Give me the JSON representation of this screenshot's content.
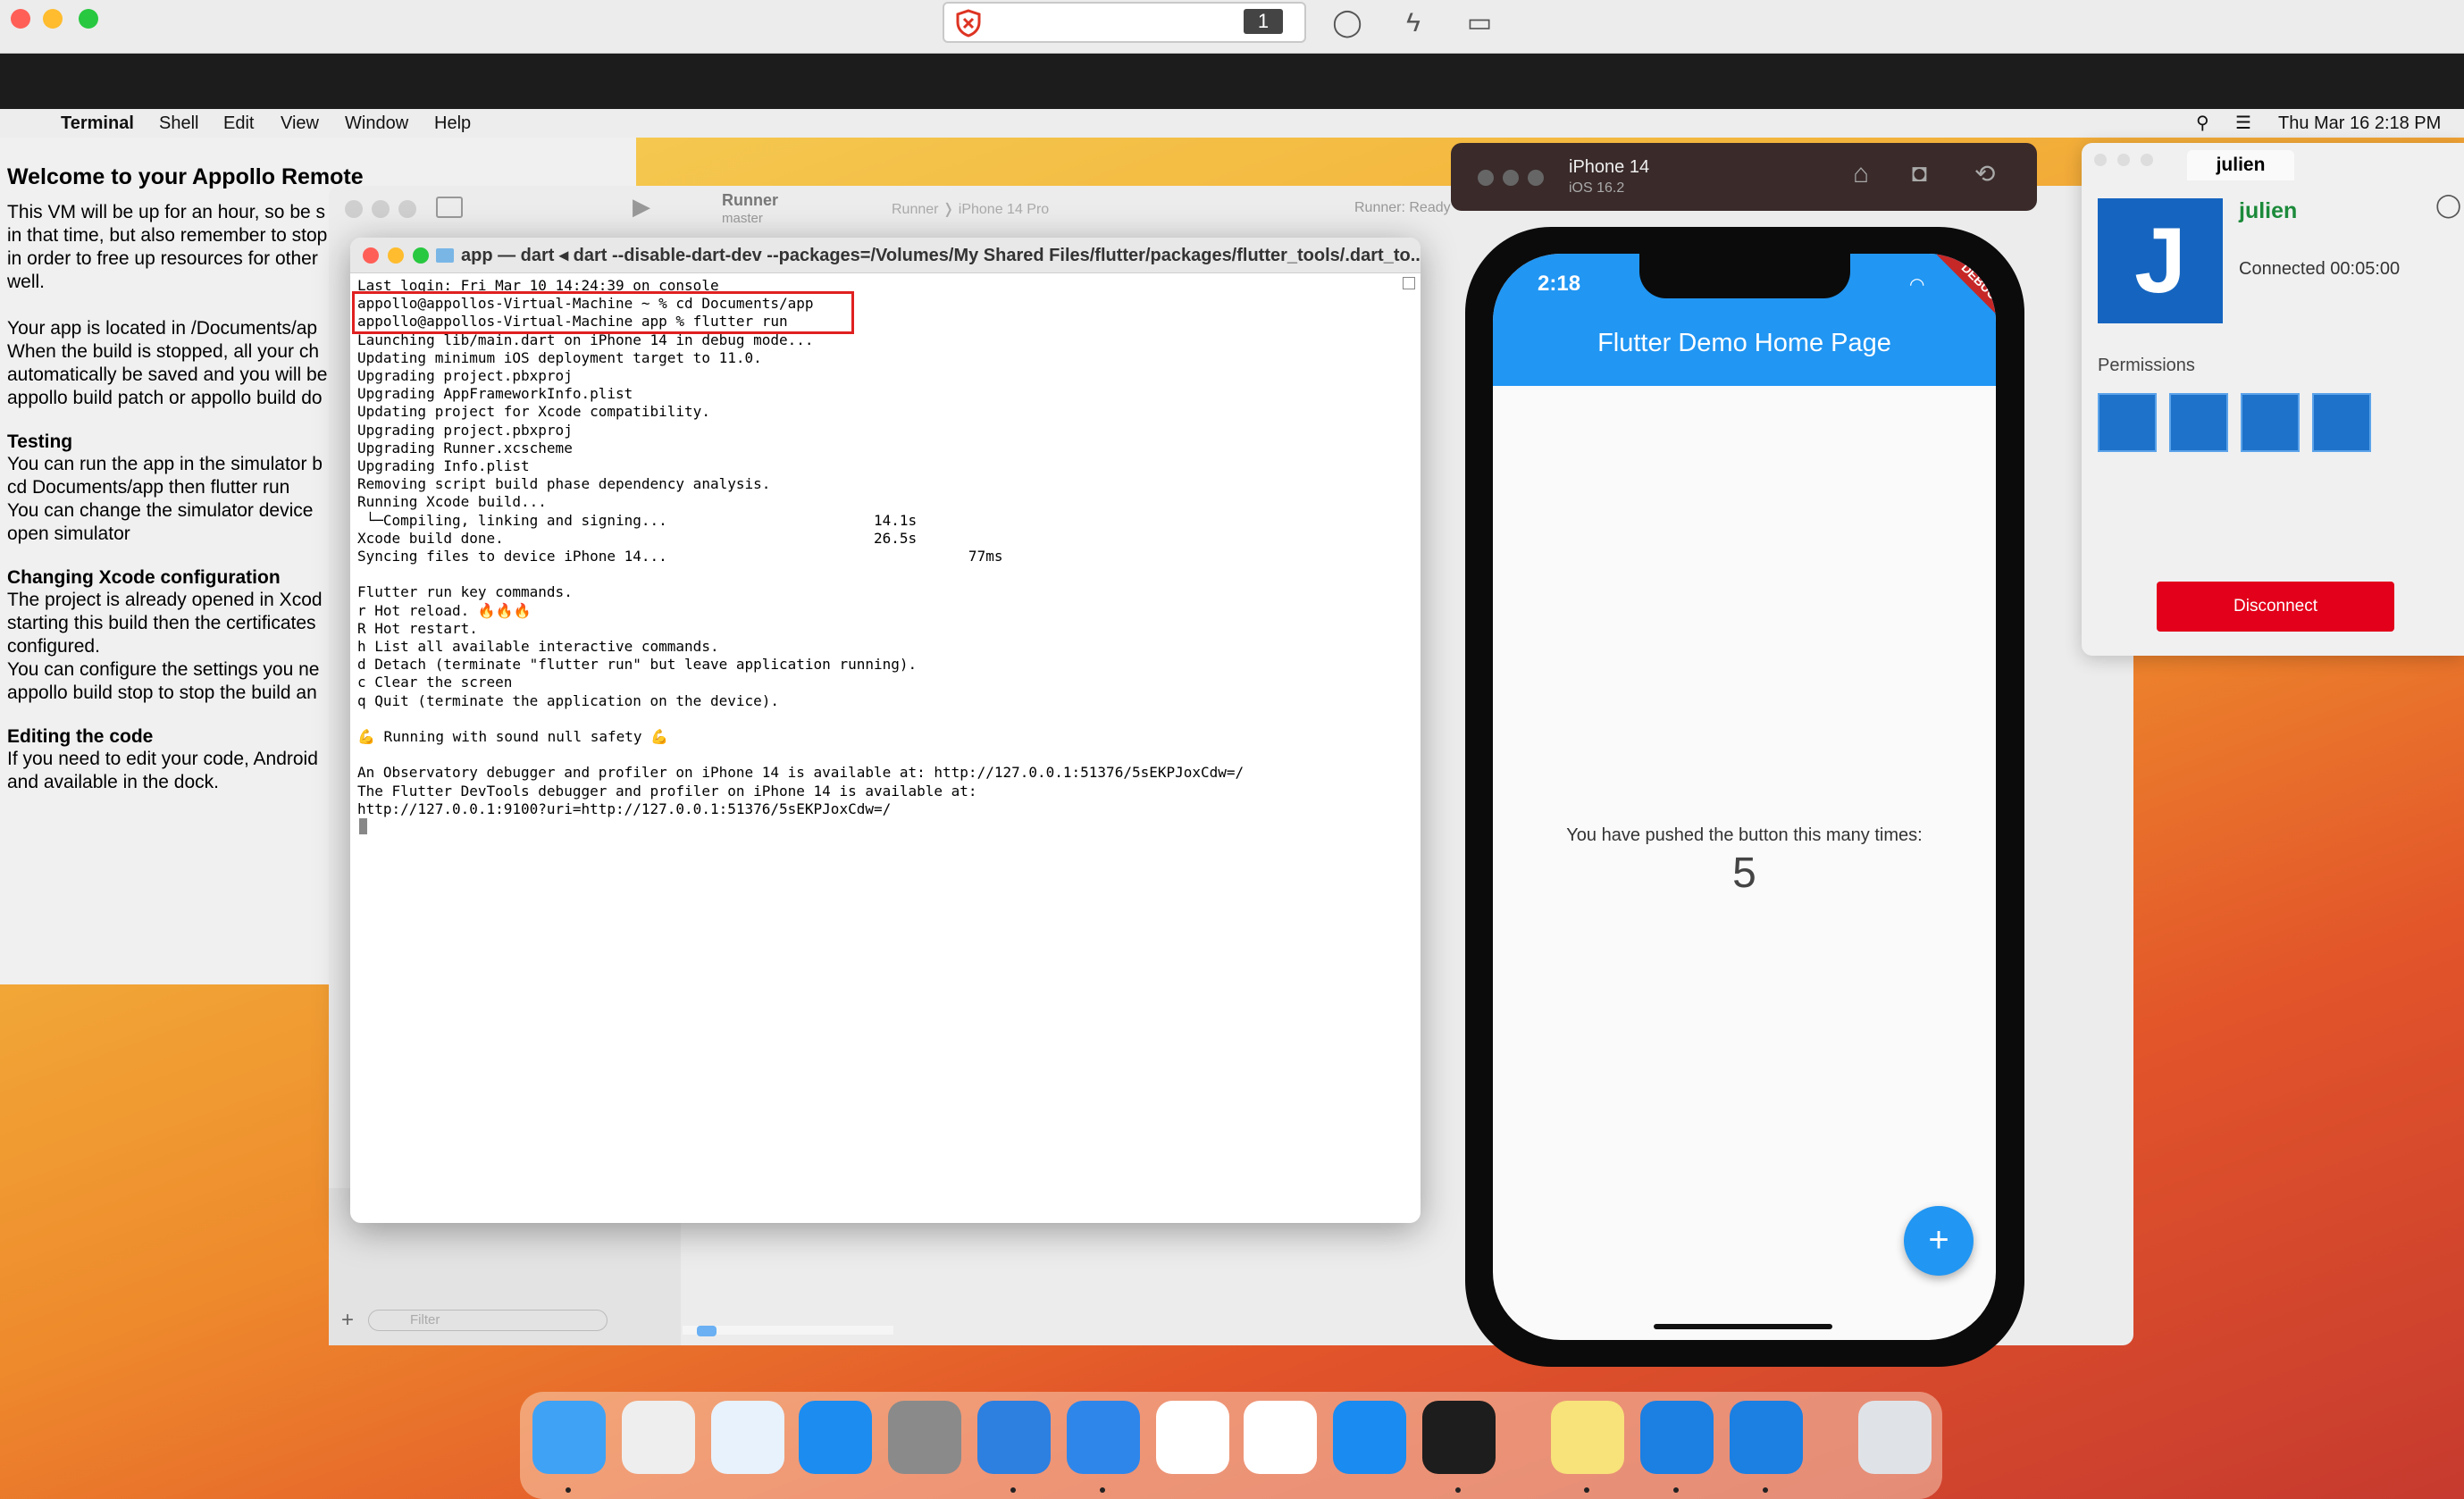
{
  "host": {
    "badge": "1",
    "icons": [
      "shield-x-icon",
      "chat-icon",
      "bolt-icon",
      "display-icon"
    ]
  },
  "menubar": {
    "app": "Terminal",
    "items": [
      "Shell",
      "Edit",
      "View",
      "Window",
      "Help"
    ],
    "clock": "Thu Mar 16  2:18 PM"
  },
  "welcome": {
    "title": "Welcome to your Appollo Remote",
    "intro": "This VM will be up for an hour, so be s\nin that time, but also remember to stop\nin order to free up resources for other\nwell.",
    "location": "Your app is located in /Documents/ap\nWhen the build is stopped, all your ch\nautomatically be saved and you will be\nappollo build patch or appollo build do",
    "testing_title": "Testing",
    "testing": "You can run the app in the simulator b\ncd Documents/app then flutter run\nYou can change the simulator device\nopen simulator",
    "xcode_title": "Changing Xcode configuration",
    "xcode": "The project is already opened in Xcod\nstarting this build then the certificates\nconfigured.\nYou can configure the settings you ne\nappollo build stop to stop the build an",
    "editing_title": "Editing the code",
    "editing": "If you need to edit your code, Android\nand available in the dock."
  },
  "xcode": {
    "scheme": "Runner",
    "branch": "master",
    "breadcrumb": "Runner ❭ iPhone 14 Pro",
    "status": "Runner: Ready",
    "filter_placeholder": "Filter"
  },
  "terminal": {
    "title": "app — dart ◂ dart --disable-dart-dev --packages=/Volumes/My Shared Files/flutter/packages/flutter_tools/.dart_to...",
    "output": "Last login: Fri Mar 10 14:24:39 on console\nappollo@appollos-Virtual-Machine ~ % cd Documents/app\nappollo@appollos-Virtual-Machine app % flutter run\nLaunching lib/main.dart on iPhone 14 in debug mode...\nUpdating minimum iOS deployment target to 11.0.\nUpgrading project.pbxproj\nUpgrading AppFrameworkInfo.plist\nUpdating project for Xcode compatibility.\nUpgrading project.pbxproj\nUpgrading Runner.xcscheme\nUpgrading Info.plist\nRemoving script build phase dependency analysis.\nRunning Xcode build...\n └─Compiling, linking and signing...                        14.1s\nXcode build done.                                           26.5s\nSyncing files to device iPhone 14...                                   77ms\n\nFlutter run key commands.\nr Hot reload. 🔥🔥🔥\nR Hot restart.\nh List all available interactive commands.\nd Detach (terminate \"flutter run\" but leave application running).\nc Clear the screen\nq Quit (terminate the application on the device).\n\n💪 Running with sound null safety 💪\n\nAn Observatory debugger and profiler on iPhone 14 is available at: http://127.0.0.1:51376/5sEKPJoxCdw=/\nThe Flutter DevTools debugger and profiler on iPhone 14 is available at:\nhttp://127.0.0.1:9100?uri=http://127.0.0.1:51376/5sEKPJoxCdw=/"
  },
  "simulator": {
    "device": "iPhone 14",
    "os": "iOS 16.2",
    "time": "2:18",
    "debug_badge": "DEBUG",
    "app_title": "Flutter Demo Home Page",
    "counter_label": "You have pushed the button this many times:",
    "counter_value": "5",
    "fab_label": "+"
  },
  "remote": {
    "tab": "julien",
    "avatar_letter": "J",
    "user": "julien",
    "status": "Connected 00:05:00",
    "permissions_label": "Permissions",
    "permissions": [
      "keyboard-mouse-icon",
      "clipboard-icon",
      "speaker-icon",
      "file-transfer-icon"
    ],
    "disconnect": "Disconnect"
  },
  "dock": [
    "finder-icon",
    "launchpad-icon",
    "safari-icon",
    "app-store-icon",
    "system-settings-icon",
    "xcode-icon",
    "instruments-icon",
    "android-studio-icon",
    "vscode-icon",
    "teamviewer-icon",
    "terminal-icon",
    "notes-icon",
    "remote-client-icon",
    "remote-client-icon",
    "trash-icon"
  ]
}
